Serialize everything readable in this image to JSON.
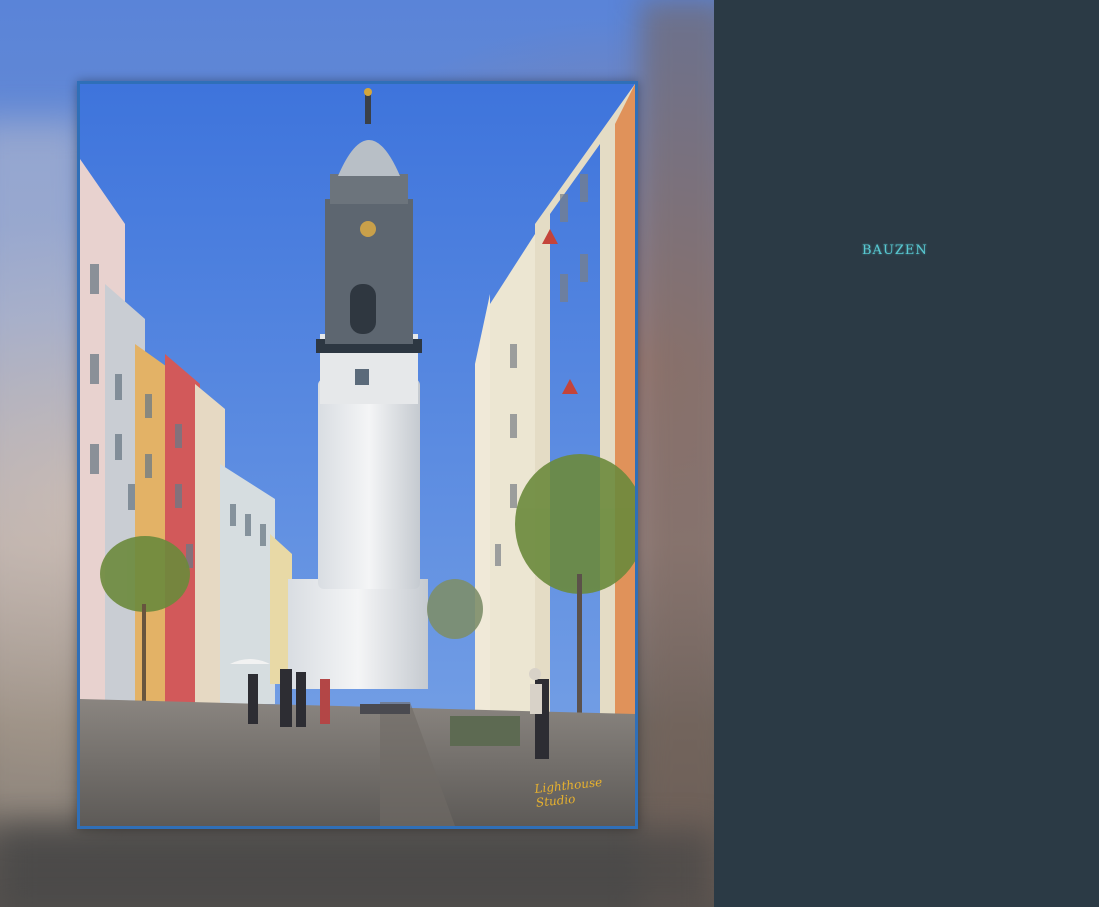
{
  "title": "BAUZEN",
  "photo": {
    "subject": "street-with-white-tower",
    "signature": "Lighthouse Studio"
  },
  "colors": {
    "panel": "#2b3a45",
    "title": "#58c9d2",
    "frame": "#2f6fb8",
    "sky": "#4f7fdc",
    "signature": "#e7b12e"
  }
}
